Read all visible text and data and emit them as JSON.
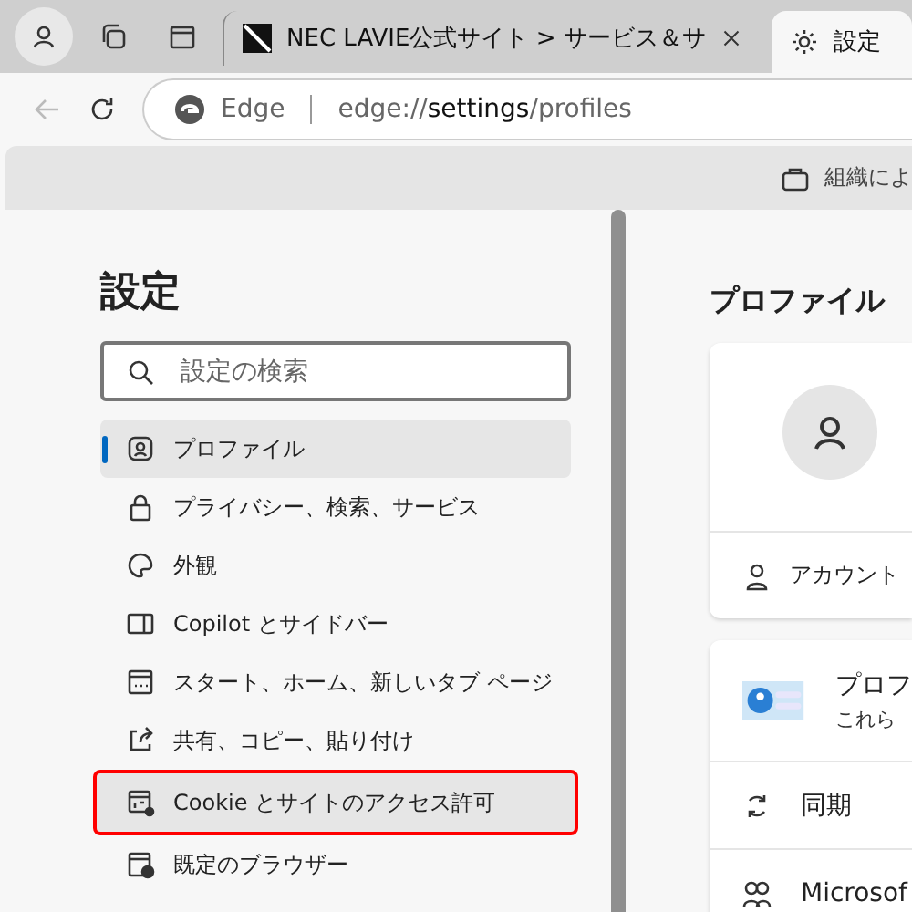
{
  "tabs": [
    {
      "label": "NEC LAVIE公式サイト > サービス＆サ",
      "selected": false
    },
    {
      "label": "設定",
      "selected": true
    }
  ],
  "address": {
    "badge": "Edge",
    "url_prefix": "edge://",
    "url_host": "settings",
    "url_path": "/profiles"
  },
  "info_bar": {
    "text": "組織によ"
  },
  "sidebar": {
    "title": "設定",
    "search": {
      "placeholder": "設定の検索"
    },
    "items": [
      {
        "label": "プロファイル",
        "selected": true,
        "highlighted": false
      },
      {
        "label": "プライバシー、検索、サービス",
        "selected": false,
        "highlighted": false
      },
      {
        "label": "外観",
        "selected": false,
        "highlighted": false
      },
      {
        "label": "Copilot とサイドバー",
        "selected": false,
        "highlighted": false
      },
      {
        "label": "スタート、ホーム、新しいタブ ページ",
        "selected": false,
        "highlighted": false
      },
      {
        "label": "共有、コピー、貼り付け",
        "selected": false,
        "highlighted": false
      },
      {
        "label": "Cookie とサイトのアクセス許可",
        "selected": false,
        "highlighted": true
      },
      {
        "label": "既定のブラウザー",
        "selected": false,
        "highlighted": false
      }
    ]
  },
  "main": {
    "title": "プロファイル",
    "account_row": "アカウント",
    "promo": {
      "title": "プロフ",
      "subtitle": "これら"
    },
    "rows": [
      {
        "label": "同期"
      },
      {
        "label": "Microsof"
      }
    ]
  }
}
